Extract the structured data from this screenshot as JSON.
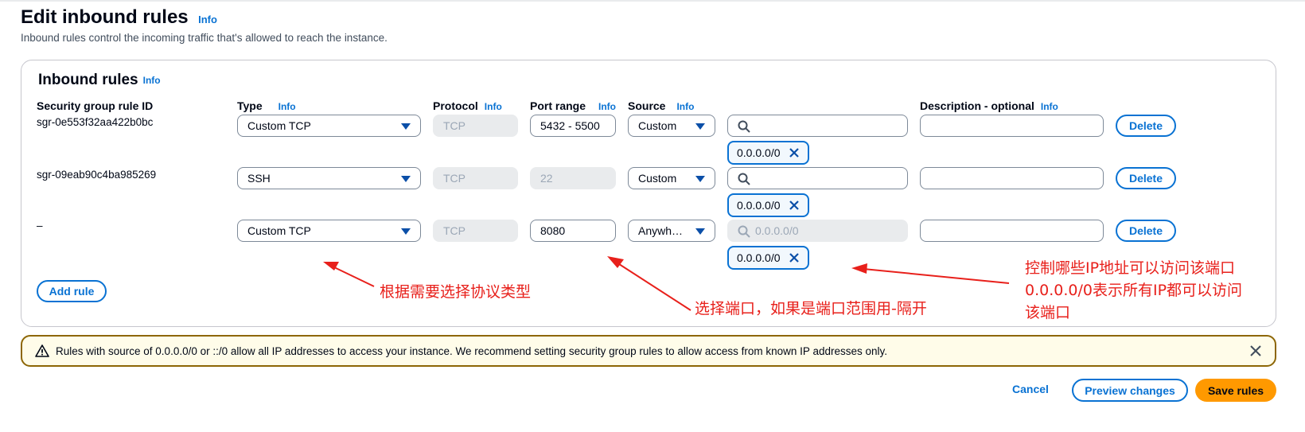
{
  "page": {
    "title": "Edit inbound rules",
    "title_info": "Info",
    "description": "Inbound rules control the incoming traffic that's allowed to reach the instance."
  },
  "panel": {
    "title": "Inbound rules",
    "title_info": "Info",
    "headers": {
      "rule_id": "Security group rule ID",
      "type": "Type",
      "protocol": "Protocol",
      "port_range": "Port range",
      "source": "Source",
      "description": "Description - optional"
    },
    "header_info": "Info",
    "rules": [
      {
        "id": "sgr-0e553f32aa422b0bc",
        "type": "Custom TCP",
        "protocol": "TCP",
        "port": "5432 - 5500",
        "source": "Custom",
        "search_value": "",
        "token": "0.0.0.0/0",
        "description": "",
        "delete": "Delete"
      },
      {
        "id": "sgr-09eab90c4ba985269",
        "type": "SSH",
        "protocol": "TCP",
        "port": "22",
        "source": "Custom",
        "search_value": "",
        "token": "0.0.0.0/0",
        "description": "",
        "delete": "Delete"
      },
      {
        "id": "–",
        "type": "Custom TCP",
        "protocol": "TCP",
        "port": "8080",
        "source": "Anywh…",
        "search_value": "0.0.0.0/0",
        "token": "0.0.0.0/0",
        "description": "",
        "delete": "Delete"
      }
    ],
    "add_rule": "Add rule"
  },
  "annotations": {
    "protocol_type": "根据需要选择协议类型",
    "port": "选择端口，如果是端口范围用-隔开",
    "ip_line1": "控制哪些IP地址可以访问该端口",
    "ip_line2": "0.0.0.0/0表示所有IP都可以访问",
    "ip_line3": "该端口"
  },
  "warning": {
    "text": "Rules with source of 0.0.0.0/0 or ::/0 allow all IP addresses to access your instance. We recommend setting security group rules to allow access from known IP addresses only."
  },
  "footer": {
    "cancel": "Cancel",
    "preview": "Preview changes",
    "save": "Save rules"
  },
  "colors": {
    "link": "#0972d3",
    "primary": "#ff9900",
    "annotation": "#e8201b",
    "warning_border": "#8d6605"
  }
}
